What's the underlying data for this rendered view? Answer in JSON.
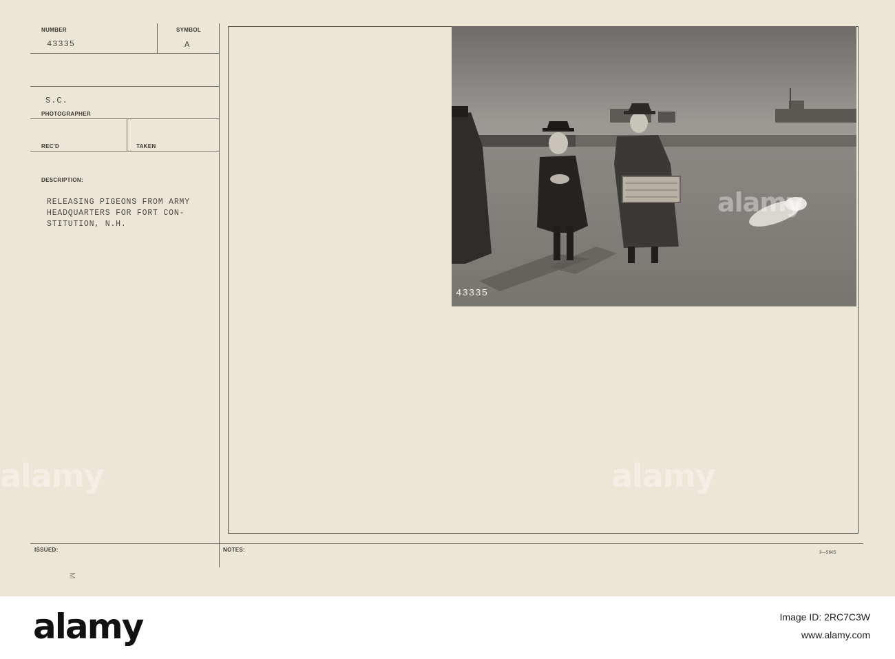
{
  "record": {
    "number_label": "NUMBER",
    "number_value": "43335",
    "symbol_label": "SYMBOL",
    "symbol_value": "A",
    "agency": "S.C.",
    "photographer_label": "PHOTOGRAPHER",
    "recd_label": "REC'D",
    "taken_label": "TAKEN",
    "description_label": "DESCRIPTION:",
    "description_lines": [
      "RELEASING PIGEONS FROM ARMY",
      "HEADQUARTERS FOR FORT CON-",
      "STITUTION, N.H."
    ],
    "issued_label": "ISSUED:",
    "notes_label": "NOTES:",
    "form_code": "3—5605",
    "margin_mark": "M"
  },
  "photo": {
    "negative_number": "43335"
  },
  "watermark_text": "alamy",
  "footer": {
    "logo": "alamy",
    "image_id": "Image ID: 2RC7C3W",
    "site": "www.alamy.com"
  }
}
